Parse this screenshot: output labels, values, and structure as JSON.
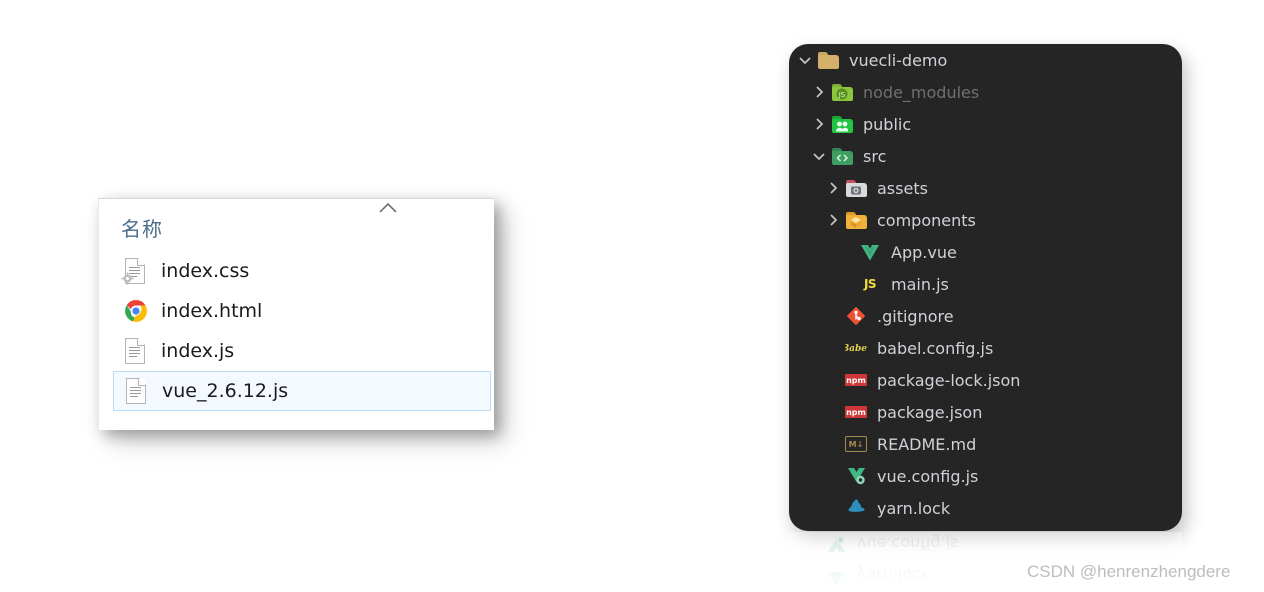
{
  "colors": {
    "tree_background": "#252526",
    "tree_text": "#cfd2d6",
    "tree_text_dim": "#6e7174",
    "selected_row_fill": "#f3f9ff",
    "selected_row_border": "#b9dcf7",
    "header_text": "#4a6d8c",
    "npm_red": "#cb3837",
    "js_yellow": "#f1dd3f",
    "vue_green": "#41b883",
    "git_red": "#f05133"
  },
  "explorer": {
    "column_header": "名称",
    "sort_indicator": "ascending-chevron",
    "files": [
      {
        "name": "index.css",
        "icon": "css-file-icon",
        "selected": false
      },
      {
        "name": "index.html",
        "icon": "chrome-icon",
        "selected": false
      },
      {
        "name": "index.js",
        "icon": "js-file-icon",
        "selected": false
      },
      {
        "name": "vue_2.6.12.js",
        "icon": "js-file-icon",
        "selected": true
      }
    ]
  },
  "tree": {
    "items": [
      {
        "label": "vuecli-demo",
        "icon": "folder-root-icon",
        "twisty": "chevron-down",
        "indent": 0,
        "dim": false
      },
      {
        "label": "node_modules",
        "icon": "folder-node-modules-icon",
        "twisty": "chevron-right",
        "indent": 1,
        "dim": true
      },
      {
        "label": "public",
        "icon": "folder-public-icon",
        "twisty": "chevron-right",
        "indent": 1,
        "dim": false
      },
      {
        "label": "src",
        "icon": "folder-src-icon",
        "twisty": "chevron-down",
        "indent": 1,
        "dim": false
      },
      {
        "label": "assets",
        "icon": "folder-assets-icon",
        "twisty": "chevron-right",
        "indent": 2,
        "dim": false
      },
      {
        "label": "components",
        "icon": "folder-components-icon",
        "twisty": "chevron-right",
        "indent": 2,
        "dim": false
      },
      {
        "label": "App.vue",
        "icon": "vue-icon",
        "twisty": "none",
        "indent": 3,
        "dim": false
      },
      {
        "label": "main.js",
        "icon": "js-icon",
        "twisty": "none",
        "indent": 3,
        "dim": false
      },
      {
        "label": ".gitignore",
        "icon": "git-icon",
        "twisty": "none",
        "indent": 2,
        "dim": false
      },
      {
        "label": "babel.config.js",
        "icon": "babel-icon",
        "twisty": "none",
        "indent": 2,
        "dim": false
      },
      {
        "label": "package-lock.json",
        "icon": "npm-icon",
        "twisty": "none",
        "indent": 2,
        "dim": false
      },
      {
        "label": "package.json",
        "icon": "npm-icon",
        "twisty": "none",
        "indent": 2,
        "dim": false
      },
      {
        "label": "README.md",
        "icon": "markdown-icon",
        "twisty": "none",
        "indent": 2,
        "dim": false
      },
      {
        "label": "vue.config.js",
        "icon": "vue-config-icon",
        "twisty": "none",
        "indent": 2,
        "dim": false
      },
      {
        "label": "yarn.lock",
        "icon": "yarn-icon",
        "twisty": "none",
        "indent": 2,
        "dim": false
      }
    ]
  },
  "reflection": {
    "items": [
      {
        "label": "yarn.lock",
        "icon": "yarn-icon"
      },
      {
        "label": "vue.config.js",
        "icon": "vue-config-icon"
      }
    ]
  },
  "watermark": {
    "text": "CSDN @henrenzhengdere"
  }
}
